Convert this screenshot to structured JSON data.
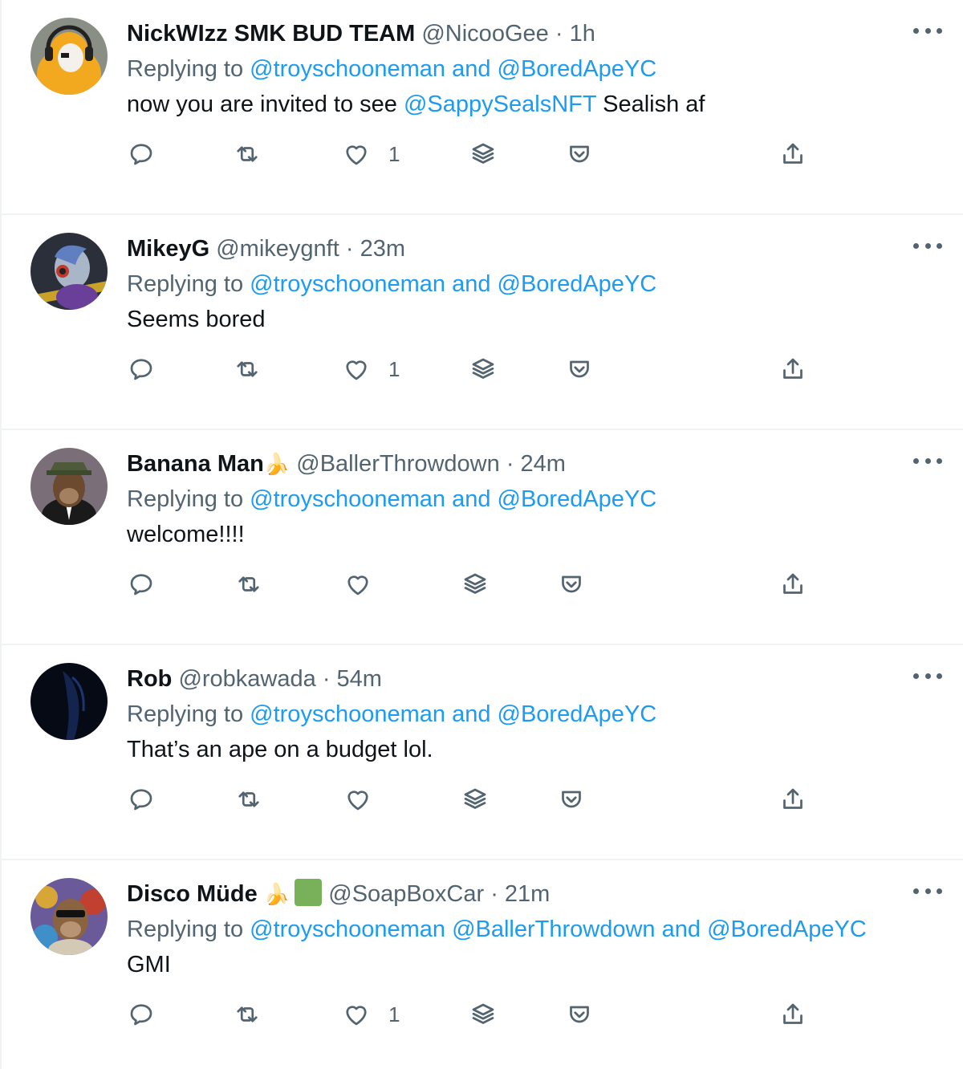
{
  "replying_prefix": "Replying to",
  "tweets": [
    {
      "name": "NickWIzz SMK BUD TEAM",
      "name_emoji": "",
      "handle": "@NicooGee",
      "time": "1h",
      "reply_mentions": [
        "@troyschooneman",
        "and",
        "@BoredApeYC"
      ],
      "body_prefix": "now you are invited to see ",
      "body_link": "@SappySealsNFT",
      "body_suffix": " Sealish af",
      "like_count": "1"
    },
    {
      "name": "MikeyG",
      "name_emoji": "",
      "handle": "@mikeygnft",
      "time": "23m",
      "reply_mentions": [
        "@troyschooneman",
        "and",
        "@BoredApeYC"
      ],
      "body_prefix": "Seems bored",
      "body_link": "",
      "body_suffix": "",
      "like_count": "1"
    },
    {
      "name": "Banana Man",
      "name_emoji": "🍌",
      "handle": "@BallerThrowdown",
      "time": "24m",
      "reply_mentions": [
        "@troyschooneman",
        "and",
        "@BoredApeYC"
      ],
      "body_prefix": "welcome!!!!",
      "body_link": "",
      "body_suffix": "",
      "like_count": ""
    },
    {
      "name": "Rob",
      "name_emoji": "",
      "handle": "@robkawada",
      "time": "54m",
      "reply_mentions": [
        "@troyschooneman",
        "and",
        "@BoredApeYC"
      ],
      "body_prefix": "That’s an ape on a budget lol.",
      "body_link": "",
      "body_suffix": "",
      "like_count": ""
    },
    {
      "name": "Disco Müde",
      "name_emoji": "🍌",
      "handle": "@SoapBoxCar",
      "time": "21m",
      "reply_mentions": [
        "@troyschooneman",
        "@BallerThrowdown",
        "and",
        "@BoredApeYC"
      ],
      "body_prefix": "GMI",
      "body_link": "",
      "body_suffix": "",
      "like_count": "1"
    }
  ],
  "colors": {
    "link": "#1d9bf0",
    "muted": "#536471",
    "text": "#0f1419",
    "divider": "#eff3f4"
  },
  "icons": [
    "reply-icon",
    "retweet-icon",
    "like-icon",
    "stack-icon",
    "pocket-icon",
    "share-icon",
    "more-icon"
  ]
}
